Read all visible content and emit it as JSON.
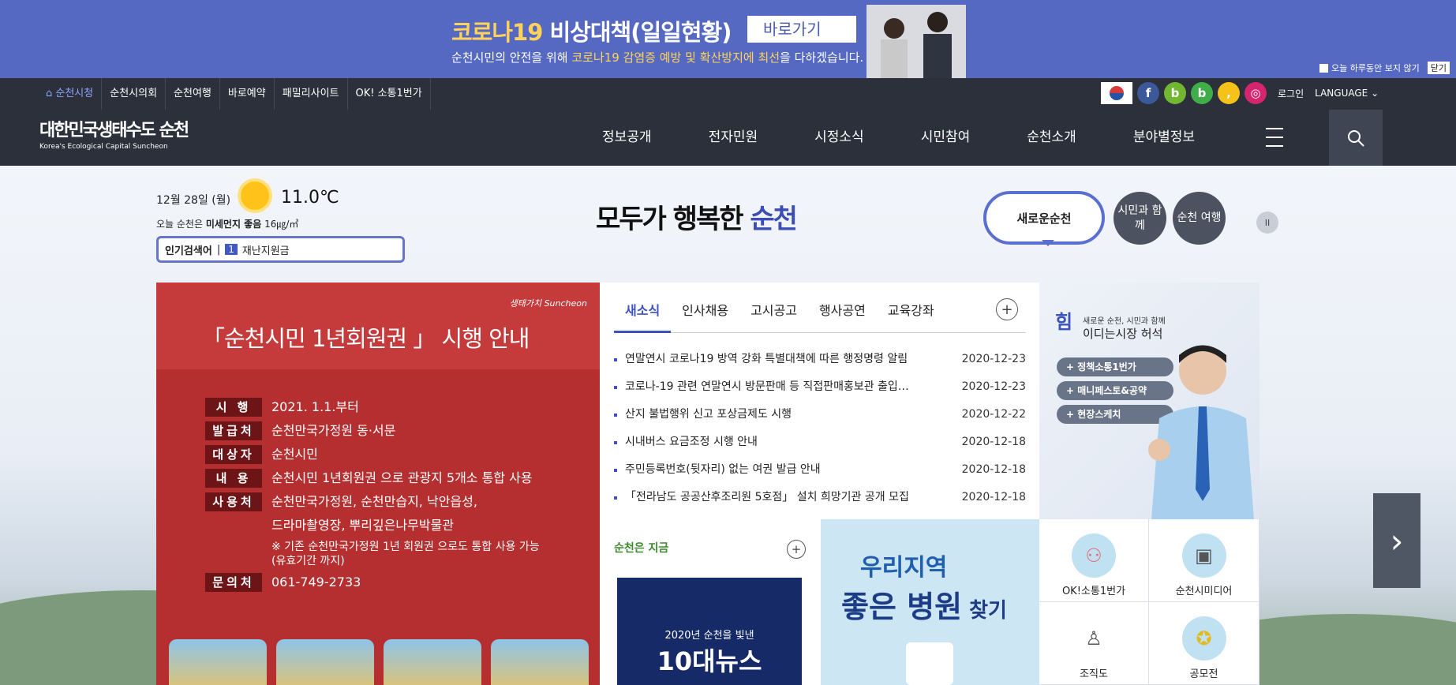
{
  "banner": {
    "title_a": "코로나19",
    "title_b": " 비상대책(일일현황)",
    "go_label": "바로가기",
    "sub_a": "순천시민의 안전을 위해 ",
    "sub_b": "코로나19 감염증 예방 및 확산방지에 최선",
    "sub_c": "을 다하겠습니다.",
    "hide_today": "오늘 하루동안 보지 않기",
    "close": "닫기"
  },
  "util": {
    "links": [
      "순천시청",
      "순천시의회",
      "순천여행",
      "바로예약",
      "패밀리사이트",
      "OK! 소통1번가"
    ],
    "login": "로그인",
    "language": "LANGUAGE"
  },
  "gnb": {
    "logo_ko": "대한민국생태수도 순천",
    "logo_en": "Korea's Ecological Capital Suncheon",
    "menu": [
      "정보공개",
      "전자민원",
      "시정소식",
      "시민참여",
      "순천소개",
      "분야별정보"
    ]
  },
  "weather": {
    "date": "12월 28일 (월)",
    "temp": "11.0℃",
    "dust_pre": "오늘 순천은 ",
    "dust_label": "미세먼지 좋음",
    "dust_val": " 16㎍/㎥"
  },
  "keyword": {
    "label": "인기검색어",
    "rank": "1",
    "word": "재난지원금"
  },
  "slogan": {
    "a": "모두가 행복한 ",
    "b": "순천"
  },
  "quicknav": {
    "bubble": "새로운순천",
    "c1": "시민과 함께",
    "c2": "순천 여행",
    "pause": "II"
  },
  "promo": {
    "brand": "생태가치 Suncheon",
    "title": "「순천시민 1년회원권 」 시행 안내",
    "rows": [
      {
        "k": "시 행",
        "v": "2021. 1.1.부터"
      },
      {
        "k": "발급처",
        "v": "순천만국가정원 동·서문"
      },
      {
        "k": "대상자",
        "v": "순천시민"
      },
      {
        "k": "내 용",
        "v": "순천시민 1년회원권 으로 관광지 5개소 통합 사용"
      },
      {
        "k": "사용처",
        "v": "순천만국가정원, 순천만습지, 낙안읍성,"
      }
    ],
    "cont": "드라마촬영장, 뿌리깊은나무박물관",
    "note": "※ 기존 순천만국가정원 1년 회원권 으로도 통합 사용 가능",
    "note2": "(유효기간 까지)",
    "contact_k": "문의처",
    "contact_v": "061-749-2733"
  },
  "news": {
    "tabs": [
      "새소식",
      "인사채용",
      "고시공고",
      "행사공연",
      "교육강좌"
    ],
    "items": [
      {
        "t": "연말연시 코로나19 방역 강화 특별대책에 따른 행정명령 알림",
        "d": "2020-12-23"
      },
      {
        "t": "코로나-19 관련 연말연시 방문판매 등 직접판매홍보관 출입…",
        "d": "2020-12-23"
      },
      {
        "t": "산지 불법행위 신고 포상금제도 시행",
        "d": "2020-12-22"
      },
      {
        "t": "시내버스 요금조정 시행 안내",
        "d": "2020-12-18"
      },
      {
        "t": "주민등록번호(뒷자리) 없는 여권 발급 안내",
        "d": "2020-12-18"
      },
      {
        "t": "「전라남도 공공산후조리원 5호점」 설치 희망기관 공개 모집",
        "d": "2020-12-18"
      }
    ]
  },
  "mayor": {
    "q": "힘",
    "sub1": "새로운 순천, 시민과 함께",
    "sub2": "이디는시장 허석",
    "btns": [
      "+ 정책소통1번가",
      "+ 매니페스토&공약",
      "+ 현장스케치"
    ]
  },
  "cal": {
    "label": "순천은 지금",
    "year": "2020년 순천을 빛낸",
    "big": "10대뉴스"
  },
  "hosp": {
    "a": "우리지역",
    "b1": "좋은 ",
    "b2": "병원",
    "b3": " 찾기"
  },
  "quick": [
    "OK!소통1번가",
    "순천시미디어",
    "조직도",
    "공모전"
  ]
}
